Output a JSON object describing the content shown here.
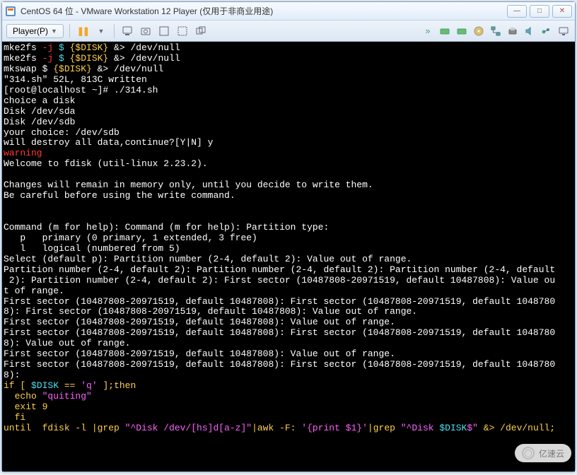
{
  "window": {
    "title": "CentOS 64 位 - VMware Workstation 12 Player (仅用于非商业用途)"
  },
  "toolbar": {
    "player_label": "Player(P)"
  },
  "icons": {
    "app": "vmware",
    "minimize": "—",
    "maximize": "□",
    "close": "✕",
    "pause": "❚❚",
    "send": "⤴",
    "printer": "🖶",
    "disk": "💾",
    "fullscreen1": "⛶",
    "fullscreen2": "⛶",
    "unity": "▭",
    "chevrons": "»",
    "dev_drive1": "💾",
    "dev_drive2": "💾",
    "dev_cd": "💿",
    "dev_net": "🖧",
    "dev_printer": "🖶",
    "dev_sound": "🔊",
    "dev_usb": "ᛞ",
    "dev_display": "🖵"
  },
  "terminal": {
    "l01a": "mke2fs ",
    "l01b": "-j ",
    "l01c": "$ ",
    "l01d": "{$DISK}",
    "l01e": " &> /dev/null",
    "l02a": "mke2fs ",
    "l02b": "-j ",
    "l02c": "$ ",
    "l02d": "{$DISK}",
    "l02e": " &> /dev/null",
    "l03a": "mkswap $ ",
    "l03b": "{$DISK}",
    "l03c": " &> /dev/null",
    "l04": "\"314.sh\" 52L, 813C written",
    "l05": "[root@localhost ~]# ./314.sh",
    "l06": "choice a disk",
    "l07": "Disk /dev/sda",
    "l08": "Disk /dev/sdb",
    "l09": "your choice: /dev/sdb",
    "l10": "will destroy all data,continue?[Y|N] y",
    "l11": "warning",
    "l12": "Welcome to fdisk (util-linux 2.23.2).",
    "l13": "",
    "l14": "Changes will remain in memory only, until you decide to write them.",
    "l15": "Be careful before using the write command.",
    "l16": "",
    "l17": "",
    "l18": "Command (m for help): Command (m for help): Partition type:",
    "l19": "   p   primary (0 primary, 1 extended, 3 free)",
    "l20": "   l   logical (numbered from 5)",
    "l21": "Select (default p): Partition number (2-4, default 2): Value out of range.",
    "l22": "Partition number (2-4, default 2): Partition number (2-4, default 2): Partition number (2-4, default",
    "l23": " 2): Partition number (2-4, default 2): First sector (10487808-20971519, default 10487808): Value ou",
    "l24": "t of range.",
    "l25": "First sector (10487808-20971519, default 10487808): First sector (10487808-20971519, default 1048780",
    "l26": "8): First sector (10487808-20971519, default 10487808): Value out of range.",
    "l27": "First sector (10487808-20971519, default 10487808): Value out of range.",
    "l28": "First sector (10487808-20971519, default 10487808): First sector (10487808-20971519, default 1048780",
    "l29": "8): Value out of range.",
    "l30": "First sector (10487808-20971519, default 10487808): Value out of range.",
    "l31": "First sector (10487808-20971519, default 10487808): First sector (10487808-20971519, default 1048780",
    "l32": "8):",
    "l33a": "if [ ",
    "l33b": "$DISK",
    "l33c": " == ",
    "l33d": "'q' ",
    "l33e": "];then",
    "l34a": "  echo ",
    "l34b": "\"quiting\"",
    "l35": "  exit 9",
    "l36": "  fi",
    "l37a": "until  fdisk -l |grep ",
    "l37b": "\"^Disk /dev/[hs]d[a-z]\"",
    "l37c": "|awk -F: ",
    "l37d": "'{print $1}'",
    "l37e": "|grep ",
    "l37f": "\"^Disk ",
    "l37g": "$DISK",
    "l37h": "$\"",
    "l37i": " &> /dev/null;"
  },
  "watermark": "亿速云"
}
